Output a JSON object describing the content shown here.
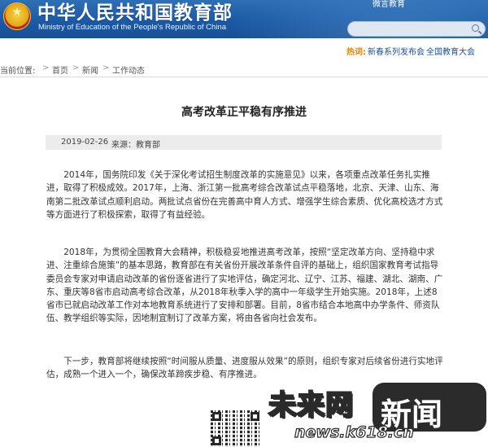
{
  "header": {
    "title": "中华人民共和国教育部",
    "subtitle": "Ministry of Education of the People's Republic of China",
    "top_link": "微言教育",
    "emblem_icon": "national-emblem-icon",
    "search": {
      "value": "",
      "placeholder": ""
    }
  },
  "hotbar": {
    "label": "热词:",
    "links": [
      "新春系列发布会",
      "全国教育大会"
    ]
  },
  "breadcrumb": {
    "prefix": "当前位置:",
    "items": [
      "首页",
      "新闻",
      "工作动态"
    ],
    "separator": ">"
  },
  "article": {
    "title": "高考改革正平稳有序推进",
    "date": "2019-02-26",
    "source": "来源：教育部",
    "paragraphs": [
      "2014年，国务院印发《关于深化考试招生制度改革的实施意见》以来，各项重点改革任务扎实推进，取得了积极成效。2017年，上海、浙江第一批高考综合改革试点平稳落地，北京、天津、山东、海南第二批改革试点顺利启动。两批试点省份在完善高中育人方式、增强学生综合素质、优化高校选才方式等方面进行了积极探索，取得了有益经验。",
      "2018年，为贯彻全国教育大会精神，积极稳妥地推进高考改革，按照“坚定改革方向、坚持稳中求进、注重综合施策”的基本思路，教育部在有关省份开展改革条件自评的基础上，组织国家教育考试指导委员会专家对申请启动改革的省份逐省进行了实地评估，确定河北、辽宁、江苏、福建、湖北、湖南、广东、重庆等8省市启动高考综合改革，从2018年秋季入学的高中一年级学生开始实施。2018年，上述8省市已就启动改革工作对本地教育系统进行了安排和部署。目前，8省市结合本地高中办学条件、师资队伍、教学组织等实际，因地制宜制订了改革方案，将由各省向社会发布。",
      "下一步，教育部将继续按照“时间服从质量、进度服从效果”的原则，组织专家对后续省份进行实地评估，成熟一个进入一个，确保改革蹄疾步稳、有序推进。"
    ]
  },
  "watermark": {
    "brand": "未来网",
    "news": "新闻",
    "url": "news.k618.cn",
    "qr_icon": "qr-code-icon"
  },
  "colors": {
    "header_blue": "#1b5aa6",
    "hot_label": "#e0860a",
    "link_blue": "#1b4f94"
  }
}
